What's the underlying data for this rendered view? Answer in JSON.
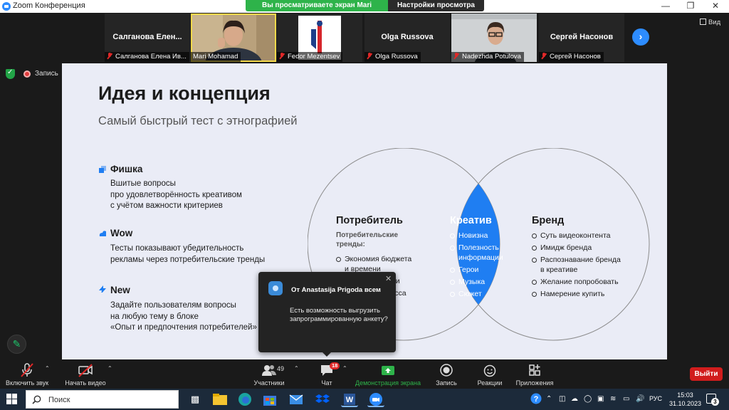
{
  "window": {
    "title": "Zoom Конференция"
  },
  "share_banner": {
    "viewing": "Вы просматриваете экран Mari Mohamad",
    "settings": "Настройки просмотра"
  },
  "view_label": "Вид",
  "participants": [
    {
      "big_name": "Салганова   Елен...",
      "label": "Салганова Елена Ив..."
    },
    {
      "big_name": "",
      "label": "Mari Mohamad"
    },
    {
      "big_name": "",
      "label": "Fedor Mezentsev"
    },
    {
      "big_name": "Olga Russova",
      "label": "Olga Russova"
    },
    {
      "big_name": "",
      "label": "Nadezhda Potulova"
    },
    {
      "big_name": "Сергей Насонов",
      "label": "Сергей Насонов"
    }
  ],
  "recording": {
    "label": "Запись"
  },
  "slide": {
    "title": "Идея и концепция",
    "subtitle": "Самый быстрый тест с этнографией",
    "features": [
      {
        "title": "Фишка",
        "lines": [
          "Вшитые вопросы",
          "про удовлетворённость креативом",
          "с учётом важности критериев"
        ]
      },
      {
        "title": "Wow",
        "lines": [
          "Тесты показывают убедительность",
          "рекламы через потребительские тренды"
        ]
      },
      {
        "title": "New",
        "lines": [
          "Задайте пользователям вопросы",
          "на любую тему в блоке",
          "«Опыт и предпочтения потребителей»"
        ]
      }
    ],
    "venn": {
      "left": {
        "title": "Потребитель",
        "sub": [
          "Потребительские",
          "тренды:"
        ],
        "items": [
          "Экономия бюджета и времени",
          "Простота жизни",
          "Эмоции процесса"
        ]
      },
      "center": {
        "title": "Креатив",
        "items": [
          "Новизна",
          "Полезность информации",
          "Герои",
          "Музыка",
          "Сюжет"
        ]
      },
      "right": {
        "title": "Бренд",
        "items": [
          "Суть видеоконтента",
          "Имидж бренда",
          "Распознавание бренда в креативе",
          "Желание попробовать",
          "Намерение купить"
        ]
      }
    },
    "colors": {
      "background": "#eaecf6",
      "accent": "#1f7ef2"
    }
  },
  "chat_toast": {
    "from": "От Anastasija Prigoda всем",
    "message": "Есть возможность выгрузить запрограммированную анкету?"
  },
  "toolbar": {
    "audio": "Включить звук",
    "video": "Начать видео",
    "participants_label": "Участники",
    "participants_count": "49",
    "chat": "Чат",
    "chat_badge": "18",
    "share": "Демонстрация экрана",
    "record": "Запись",
    "reactions": "Реакции",
    "apps": "Приложения",
    "leave": "Выйти"
  },
  "taskbar": {
    "search_placeholder": "Поиск",
    "lang": "РУС",
    "time": "15:03",
    "date": "31.10.2023",
    "notifications": "3"
  }
}
